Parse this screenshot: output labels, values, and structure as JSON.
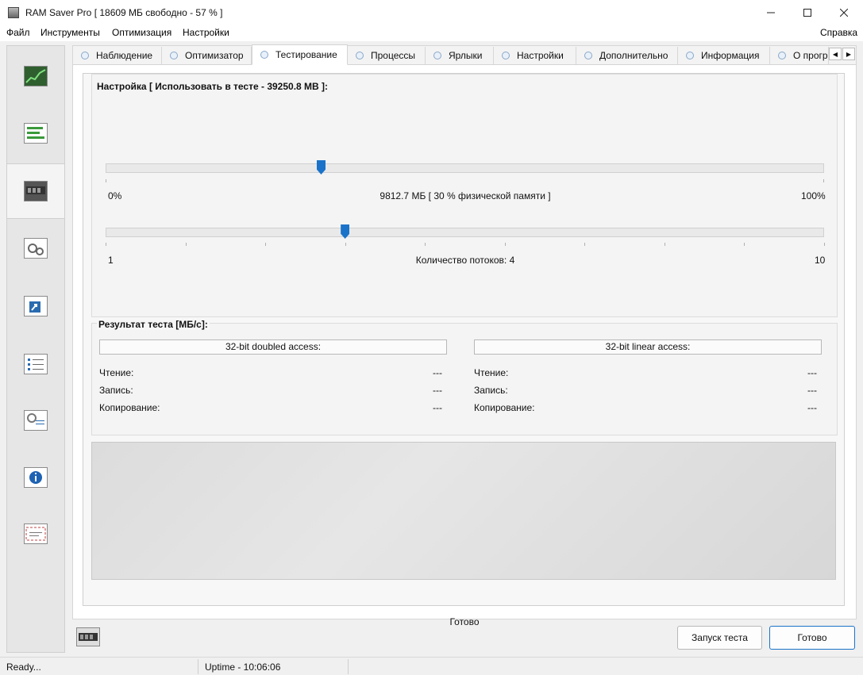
{
  "window": {
    "title": "RAM Saver Pro [ 18609 МБ свободно - 57 % ]",
    "min_icon": "minimize-icon",
    "max_icon": "maximize-icon",
    "close_icon": "close-icon"
  },
  "menu": {
    "file": "Файл",
    "tools": "Инструменты",
    "optimize": "Оптимизация",
    "settings": "Настройки",
    "help": "Справка"
  },
  "sidebar": {
    "items": [
      {
        "icon": "monitor-chart-icon"
      },
      {
        "icon": "list-bars-icon"
      },
      {
        "icon": "ram-chip-icon",
        "active": true
      },
      {
        "icon": "gears-icon"
      },
      {
        "icon": "shortcut-icon"
      },
      {
        "icon": "checklist-icon"
      },
      {
        "icon": "settings-checklist-icon"
      },
      {
        "icon": "info-icon"
      },
      {
        "icon": "mail-icon"
      }
    ]
  },
  "tabs": [
    {
      "label": "Наблюдение"
    },
    {
      "label": "Оптимизатор"
    },
    {
      "label": "Тестирование",
      "active": true
    },
    {
      "label": "Процессы"
    },
    {
      "label": "Ярлыки"
    },
    {
      "label": "Настройки"
    },
    {
      "label": "Дополнительно"
    },
    {
      "label": "Информация"
    },
    {
      "label": "О прогр"
    }
  ],
  "tab_scroll": {
    "left": "◀",
    "right": "▶"
  },
  "settings_group": {
    "title": "Настройка [ Использовать в тесте - 39250.8 MB ]:",
    "memory_slider": {
      "min_label": "0%",
      "max_label": "100%",
      "value_label": "9812.7 МБ [ 30 % физической памяти ]",
      "value_percent": 30
    },
    "threads_slider": {
      "min_label": "1",
      "max_label": "10",
      "value_label": "Количество потоков: 4",
      "value": 4,
      "min": 1,
      "max": 10
    }
  },
  "results_group": {
    "title": "Результат теста [МБ/с]:",
    "left": {
      "header": "32-bit doubled access:",
      "rows": [
        {
          "label": "Чтение:",
          "value": "---"
        },
        {
          "label": "Запись:",
          "value": "---"
        },
        {
          "label": "Копирование:",
          "value": "---"
        }
      ]
    },
    "right": {
      "header": "32-bit linear access:",
      "rows": [
        {
          "label": "Чтение:",
          "value": "---"
        },
        {
          "label": "Запись:",
          "value": "---"
        },
        {
          "label": "Копирование:",
          "value": "---"
        }
      ]
    }
  },
  "status_message": "Готово",
  "buttons": {
    "start_test": "Запуск теста",
    "done": "Готово"
  },
  "statusbar": {
    "ready": "Ready...",
    "uptime": "Uptime - 10:06:06"
  }
}
